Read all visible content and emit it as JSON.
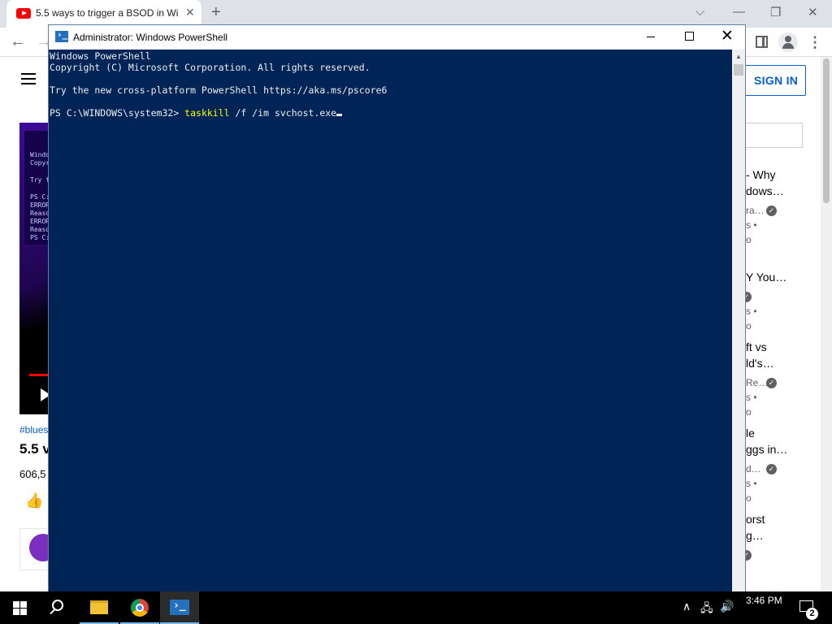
{
  "browser": {
    "tab_title": "5.5 ways to trigger a BSOD in Wi",
    "tab_close": "✕",
    "new_tab": "+",
    "window_controls": {
      "dropdown": "⌵",
      "minimize": "—",
      "restore": "❐",
      "close": "✕"
    },
    "nav": {
      "back": "←",
      "forward": "→",
      "menu": "⋮"
    }
  },
  "youtube": {
    "signin": "SIGN IN",
    "hashtag": "#blues",
    "video_title": "5.5 v",
    "views": "606,5",
    "like_icon": "👍",
    "video_lines": [
      "Window",
      "Copyri",
      "",
      "Try th",
      "",
      "PS C:\\",
      "ERROR:",
      "Reason",
      "ERROR:",
      "Reason",
      "PS C:\\"
    ],
    "recommendations": [
      {
        "line1": "- Why",
        "line2": "dows…",
        "meta1": "ra…",
        "meta2": "s •",
        "meta3": "o",
        "verified": true
      },
      {
        "line1": "Y You…",
        "line2": "",
        "meta1": "",
        "meta2": "s •",
        "meta3": "o",
        "verified": true
      },
      {
        "line1": "ft vs",
        "line2": "ld's…",
        "meta1": "Re…",
        "meta2": "s •",
        "meta3": "o",
        "verified": true
      },
      {
        "line1": "le",
        "line2": "ggs in…",
        "meta1": "d…",
        "meta2": "s •",
        "meta3": "o",
        "verified": true
      },
      {
        "line1": "orst",
        "line2": "g…",
        "meta1": "",
        "meta2": "",
        "meta3": "",
        "verified": true
      }
    ]
  },
  "powershell": {
    "window_title": "Administrator: Windows PowerShell",
    "close_glyph": "✕",
    "lines": [
      "Windows PowerShell",
      "Copyright (C) Microsoft Corporation. All rights reserved.",
      "",
      "Try the new cross-platform PowerShell https://aka.ms/pscore6",
      ""
    ],
    "prompt": "PS C:\\WINDOWS\\system32> ",
    "command": "taskkill",
    "args": " /f /im svchost.exe"
  },
  "taskbar": {
    "time": "3:46 PM",
    "notification_count": "2",
    "tray_chevron": "∧",
    "tray_network": "🖧",
    "tray_volume": "🔊"
  }
}
